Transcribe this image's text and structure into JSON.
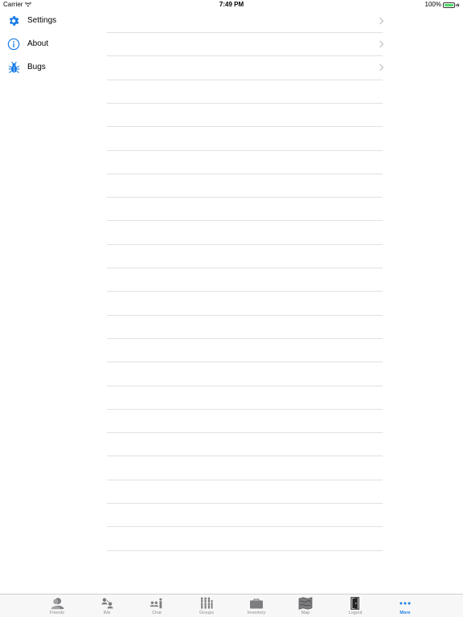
{
  "status_bar": {
    "carrier": "Carrier",
    "time": "7:49 PM",
    "battery": "100%",
    "battery_level": 1.0
  },
  "menu": {
    "items": [
      {
        "label": "Settings",
        "icon": "gear-icon"
      },
      {
        "label": "About",
        "icon": "info-icon"
      },
      {
        "label": "Bugs",
        "icon": "bug-icon"
      }
    ]
  },
  "tab_bar": {
    "tabs": [
      {
        "label": "Friends",
        "icon": "friends-icon"
      },
      {
        "label": "IMs",
        "icon": "ims-icon"
      },
      {
        "label": "Chat",
        "icon": "chat-icon"
      },
      {
        "label": "Groups",
        "icon": "groups-icon"
      },
      {
        "label": "Inventory",
        "icon": "inventory-icon"
      },
      {
        "label": "Map",
        "icon": "map-icon"
      },
      {
        "label": "Logout",
        "icon": "logout-icon"
      },
      {
        "label": "More",
        "icon": "more-icon"
      }
    ],
    "active": "More"
  },
  "colors": {
    "accent": "#1a7ce6",
    "inactive_tab": "#8e8e93",
    "separator": "#e1e1e3",
    "battery_fill": "#4cd964"
  }
}
